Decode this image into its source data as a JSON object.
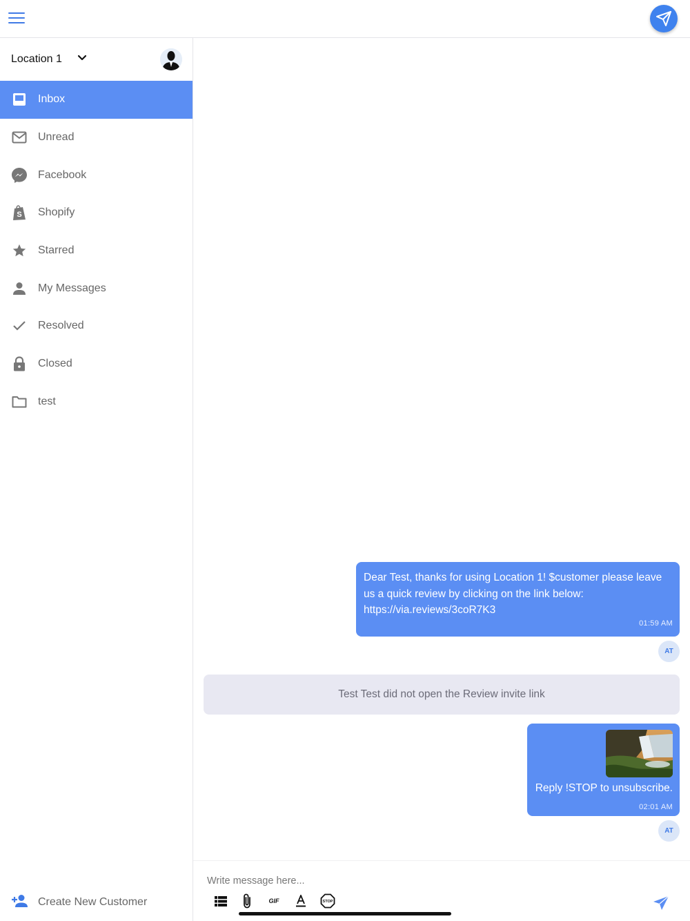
{
  "header": {
    "menu_icon": "hamburger-icon",
    "compose_icon": "paper-plane-icon"
  },
  "colors": {
    "accent": "#5b8ef3",
    "accent_dark": "#3f82ee",
    "system_message_bg": "#e8e8f2"
  },
  "sidebar": {
    "location": "Location 1",
    "items": [
      {
        "label": "Inbox",
        "icon": "inbox-icon",
        "active": true
      },
      {
        "label": "Unread",
        "icon": "envelope-icon",
        "active": false
      },
      {
        "label": "Facebook",
        "icon": "messenger-icon",
        "active": false
      },
      {
        "label": "Shopify",
        "icon": "shopify-bag-icon",
        "active": false
      },
      {
        "label": "Starred",
        "icon": "star-icon",
        "active": false
      },
      {
        "label": "My Messages",
        "icon": "person-icon",
        "active": false
      },
      {
        "label": "Resolved",
        "icon": "checkmark-icon",
        "active": false
      },
      {
        "label": "Closed",
        "icon": "lock-icon",
        "active": false
      },
      {
        "label": "test",
        "icon": "folder-icon",
        "active": false
      }
    ],
    "create_customer": "Create New Customer"
  },
  "chat": {
    "messages": [
      {
        "text": "Dear Test, thanks for using Location 1! $customer please leave us a quick review by clicking on the link below: https://via.reviews/3coR7K3",
        "time": "01:59 AM",
        "sender": "AT"
      },
      {
        "system": "Test Test did not open the Review invite link"
      },
      {
        "text": "Reply !STOP to unsubscribe.",
        "time": "02:01 AM",
        "sender": "AT",
        "attachment": "waterfall-photo"
      }
    ]
  },
  "composer": {
    "placeholder": "Write message here...",
    "tools": [
      "list-icon",
      "paperclip-icon",
      "gif-icon",
      "text-format-icon",
      "stop-sign-icon"
    ],
    "gif_label": "GIF",
    "stop_label": "STOP"
  }
}
